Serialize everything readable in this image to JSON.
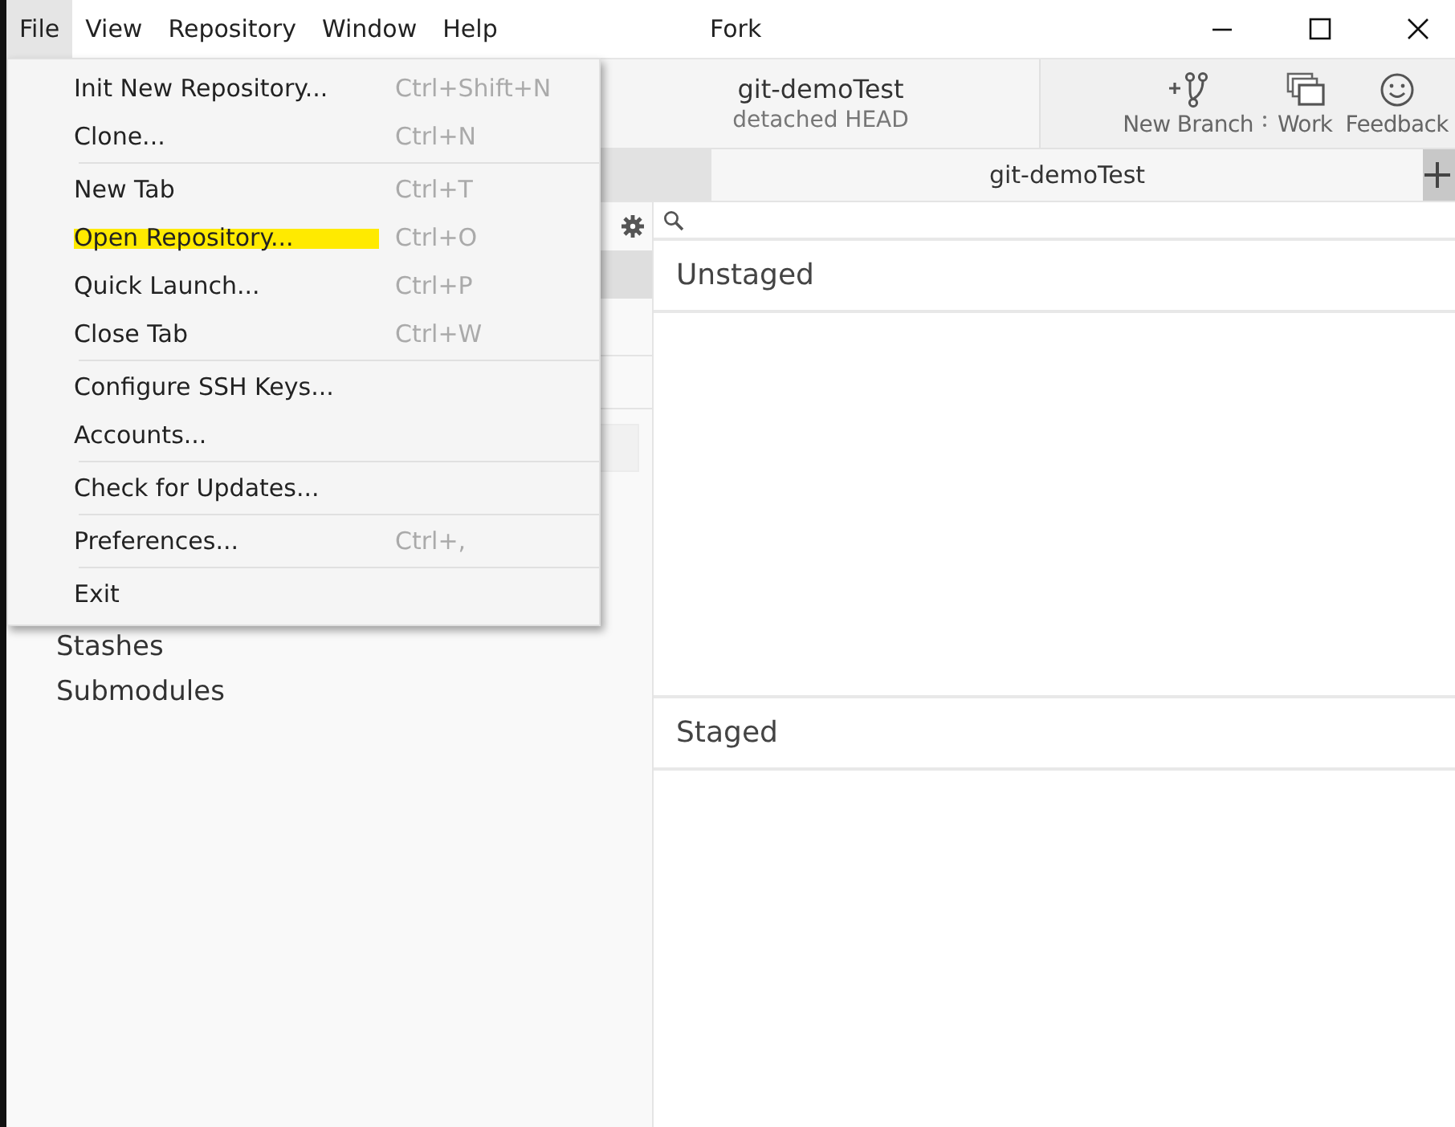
{
  "window": {
    "title": "Fork"
  },
  "menu_bar": [
    {
      "label": "File",
      "selected": true
    },
    {
      "label": "View",
      "selected": false
    },
    {
      "label": "Repository",
      "selected": false
    },
    {
      "label": "Window",
      "selected": false
    },
    {
      "label": "Help",
      "selected": false
    }
  ],
  "file_menu": [
    {
      "kind": "item",
      "label": "Init New Repository...",
      "shortcut": "Ctrl+Shift+N",
      "highlighted": false
    },
    {
      "kind": "item",
      "label": "Clone...",
      "shortcut": "Ctrl+N",
      "highlighted": false
    },
    {
      "kind": "separator"
    },
    {
      "kind": "item",
      "label": "New Tab",
      "shortcut": "Ctrl+T",
      "highlighted": false
    },
    {
      "kind": "item",
      "label": "Open Repository...",
      "shortcut": "Ctrl+O",
      "highlighted": true
    },
    {
      "kind": "item",
      "label": "Quick Launch...",
      "shortcut": "Ctrl+P",
      "highlighted": false
    },
    {
      "kind": "item",
      "label": "Close Tab",
      "shortcut": "Ctrl+W",
      "highlighted": false
    },
    {
      "kind": "separator"
    },
    {
      "kind": "item",
      "label": "Configure SSH Keys...",
      "highlighted": false
    },
    {
      "kind": "item",
      "label": "Accounts...",
      "highlighted": false
    },
    {
      "kind": "separator"
    },
    {
      "kind": "item",
      "label": "Check for Updates...",
      "highlighted": false
    },
    {
      "kind": "separator"
    },
    {
      "kind": "item",
      "label": "Preferences...",
      "shortcut": "Ctrl+,",
      "highlighted": false
    },
    {
      "kind": "separator"
    },
    {
      "kind": "item",
      "label": "Exit",
      "highlighted": false
    }
  ],
  "repository": {
    "name": "git-demoTest",
    "status": "detached HEAD"
  },
  "toolbar": [
    {
      "kind": "new-branch",
      "label": "New Branch",
      "has_dropdown": true
    },
    {
      "kind": "work",
      "label": "Work",
      "has_dropdown": false
    },
    {
      "kind": "feedback",
      "label": "Feedback",
      "has_dropdown": false
    }
  ],
  "tabs": [
    {
      "label": "git-demoTest",
      "selected": true
    }
  ],
  "sidebar": {
    "items": [
      {
        "label": "Stashes"
      },
      {
        "label": "Submodules"
      }
    ]
  },
  "changes": {
    "sections": [
      {
        "title": "Unstaged"
      },
      {
        "title": "Staged"
      }
    ]
  }
}
